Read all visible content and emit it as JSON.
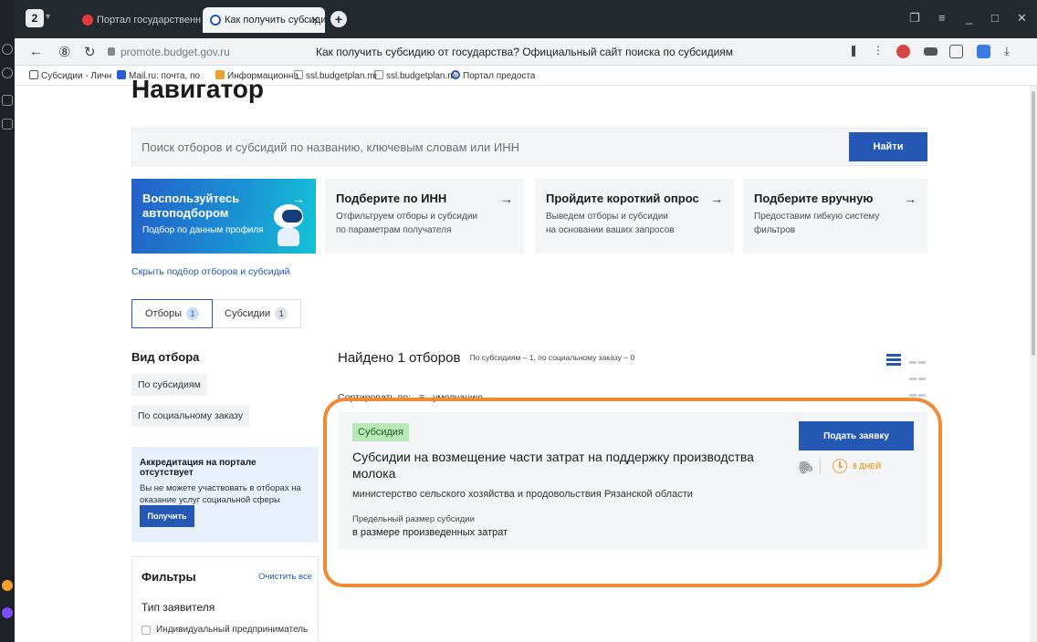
{
  "browser": {
    "tab_count": "2",
    "tabs": [
      {
        "label": "Портал государственных",
        "active": false
      },
      {
        "label": "Как получить субсидии",
        "active": true
      }
    ],
    "url": "promote.budget.gov.ru",
    "page_title": "Как получить субсидию от государства? Официальный сайт поиска по субсидиям",
    "bookmarks": [
      "Субсидии - Личн",
      "Mail.ru: почта, по",
      "Информационна",
      "ssl.budgetplan.mi",
      "ssl.budgetplan.mi",
      "Портал предоста"
    ]
  },
  "page": {
    "title": "Навигатор",
    "search": {
      "placeholder": "Поиск отборов и субсидий по названию, ключевым словам или ИНН",
      "button": "Найти"
    },
    "cards": [
      {
        "title": "Воспользуйтесь автоподбором",
        "sub": "Подбор по данным профиля"
      },
      {
        "title": "Подберите по ИНН",
        "sub1": "Отфильтруем отборы и субсидии",
        "sub2": "по параметрам получателя"
      },
      {
        "title": "Пройдите короткий опрос",
        "sub1": "Выведем отборы и субсидии",
        "sub2": "на основании ваших запросов"
      },
      {
        "title": "Подберите вручную",
        "sub1": "Предоставим гибкую систему",
        "sub2": "фильтров"
      }
    ],
    "hide_link": "Скрыть подбор отборов и субсидий",
    "segments": [
      {
        "label": "Отборы",
        "count": "1"
      },
      {
        "label": "Субсидии",
        "count": "1"
      }
    ],
    "selection_type": {
      "heading": "Вид отбора",
      "options": [
        "По субсидиям",
        "По социальному заказу"
      ]
    },
    "accreditation": {
      "title": "Аккредитация на портале отсутствует",
      "text": "Вы не можете участвовать в отборах на оказание услуг социальной сферы",
      "button": "Получить"
    },
    "filters": {
      "heading": "Фильтры",
      "clear": "Очистить все",
      "applicant_type": "Тип заявителя",
      "options": [
        "Индивидуальный предприниматель"
      ]
    },
    "results": {
      "found": "Найдено 1 отборов",
      "found_sub": "По субсидиям – 1, по социальному заказу – 0",
      "sort_label": "Сортировать по:",
      "sort_value": "умолчанию"
    },
    "result_card": {
      "badge": "Субсидия",
      "title": "Субсидии на возмещение части затрат на поддержку производства молока",
      "org": "министерство сельского хозяйства и продовольствия Рязанской области",
      "limit_label": "Предельный размер субсидии",
      "limit_value": "в размере произведенных затрат",
      "apply_button": "Подать заявку",
      "days_left": "8 ДНЕЙ"
    }
  },
  "colors": {
    "accent": "#2458b4",
    "highlight": "#f08a35",
    "deadline": "#e6a23c",
    "badge": "#b8e8b8"
  }
}
